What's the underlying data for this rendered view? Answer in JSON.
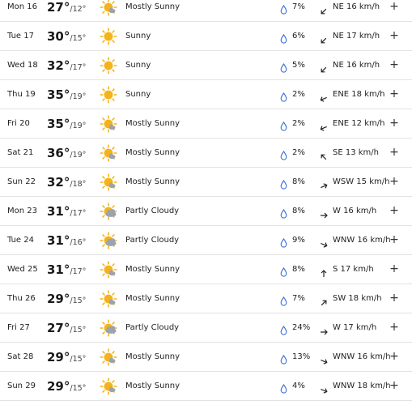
{
  "forecast": {
    "days": [
      {
        "day": "Mon 16",
        "high": "27°",
        "low": "/12°",
        "icon": "mostly-sunny-icon",
        "condition": "Mostly Sunny",
        "precip": "7%",
        "wind": "NE 16 km/h",
        "wind_dir_deg": 225,
        "expand": "+"
      },
      {
        "day": "Tue 17",
        "high": "30°",
        "low": "/15°",
        "icon": "sunny-icon",
        "condition": "Sunny",
        "precip": "6%",
        "wind": "NE 17 km/h",
        "wind_dir_deg": 225,
        "expand": "+"
      },
      {
        "day": "Wed 18",
        "high": "32°",
        "low": "/17°",
        "icon": "sunny-icon",
        "condition": "Sunny",
        "precip": "5%",
        "wind": "NE 16 km/h",
        "wind_dir_deg": 225,
        "expand": "+"
      },
      {
        "day": "Thu 19",
        "high": "35°",
        "low": "/19°",
        "icon": "sunny-icon",
        "condition": "Sunny",
        "precip": "2%",
        "wind": "ENE 18 km/h",
        "wind_dir_deg": 247,
        "expand": "+"
      },
      {
        "day": "Fri 20",
        "high": "35°",
        "low": "/19°",
        "icon": "mostly-sunny-icon",
        "condition": "Mostly Sunny",
        "precip": "2%",
        "wind": "ENE 12 km/h",
        "wind_dir_deg": 247,
        "expand": "+"
      },
      {
        "day": "Sat 21",
        "high": "36°",
        "low": "/19°",
        "icon": "mostly-sunny-icon",
        "condition": "Mostly Sunny",
        "precip": "2%",
        "wind": "SE 13 km/h",
        "wind_dir_deg": 315,
        "expand": "+"
      },
      {
        "day": "Sun 22",
        "high": "32°",
        "low": "/18°",
        "icon": "mostly-sunny-icon",
        "condition": "Mostly Sunny",
        "precip": "8%",
        "wind": "WSW 15 km/h",
        "wind_dir_deg": 67,
        "expand": "+"
      },
      {
        "day": "Mon 23",
        "high": "31°",
        "low": "/17°",
        "icon": "partly-cloudy-icon",
        "condition": "Partly Cloudy",
        "precip": "8%",
        "wind": "W 16 km/h",
        "wind_dir_deg": 90,
        "expand": "+"
      },
      {
        "day": "Tue 24",
        "high": "31°",
        "low": "/16°",
        "icon": "partly-cloudy-icon",
        "condition": "Partly Cloudy",
        "precip": "9%",
        "wind": "WNW 16 km/h",
        "wind_dir_deg": 112,
        "expand": "+"
      },
      {
        "day": "Wed 25",
        "high": "31°",
        "low": "/17°",
        "icon": "mostly-sunny-icon",
        "condition": "Mostly Sunny",
        "precip": "8%",
        "wind": "S 17 km/h",
        "wind_dir_deg": 0,
        "expand": "+"
      },
      {
        "day": "Thu 26",
        "high": "29°",
        "low": "/15°",
        "icon": "mostly-sunny-icon",
        "condition": "Mostly Sunny",
        "precip": "7%",
        "wind": "SW 18 km/h",
        "wind_dir_deg": 45,
        "expand": "+"
      },
      {
        "day": "Fri 27",
        "high": "27°",
        "low": "/15°",
        "icon": "partly-cloudy-icon",
        "condition": "Partly Cloudy",
        "precip": "24%",
        "wind": "W 17 km/h",
        "wind_dir_deg": 90,
        "expand": "+"
      },
      {
        "day": "Sat 28",
        "high": "29°",
        "low": "/15°",
        "icon": "mostly-sunny-icon",
        "condition": "Mostly Sunny",
        "precip": "13%",
        "wind": "WNW 16 km/h",
        "wind_dir_deg": 112,
        "expand": "+"
      },
      {
        "day": "Sun 29",
        "high": "29°",
        "low": "/15°",
        "icon": "mostly-sunny-icon",
        "condition": "Mostly Sunny",
        "precip": "4%",
        "wind": "WNW 18 km/h",
        "wind_dir_deg": 112,
        "expand": "+"
      }
    ]
  },
  "colors": {
    "sun": "#f5b21a",
    "cloud": "#9aa4b0",
    "drop": "#3b6fd6",
    "divider": "#e3e3e3",
    "text": "#222222"
  }
}
